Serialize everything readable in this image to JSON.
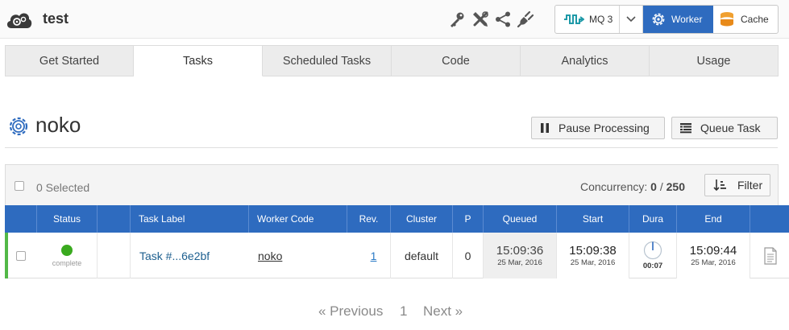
{
  "app": {
    "title": "test",
    "logo_icon": "cloud-gear-icon"
  },
  "toolbar_icons": [
    "key-icon",
    "tools-icon",
    "share-icon",
    "plug-icon"
  ],
  "services": {
    "mq_label": "MQ 3",
    "worker_label": "Worker",
    "cache_label": "Cache",
    "active": "Worker",
    "accent_color": "#2e6bbf"
  },
  "tabs": [
    {
      "label": "Get Started",
      "active": false
    },
    {
      "label": "Tasks",
      "active": true
    },
    {
      "label": "Scheduled Tasks",
      "active": false
    },
    {
      "label": "Code",
      "active": false
    },
    {
      "label": "Analytics",
      "active": false
    },
    {
      "label": "Usage",
      "active": false
    }
  ],
  "page": {
    "title": "noko",
    "pause_label": "Pause Processing",
    "queue_label": "Queue Task"
  },
  "table_toolbar": {
    "selected_text": "0 Selected",
    "concurrency_label": "Concurrency:",
    "concurrency_current": "0",
    "concurrency_sep": "/",
    "concurrency_max": "250",
    "filter_label": "Filter"
  },
  "columns": [
    "Status",
    "",
    "Task Label",
    "Worker Code",
    "Rev.",
    "Cluster",
    "P",
    "Queued",
    "Start",
    "Dura",
    "End",
    ""
  ],
  "rows": [
    {
      "status": "complete",
      "status_color": "#3aaa1f",
      "task_label": "Task #...6e2bf",
      "worker_code": "noko",
      "rev": "1",
      "cluster": "default",
      "priority": "0",
      "queued_time": "15:09:36",
      "queued_date": "25 Mar, 2016",
      "start_time": "15:09:38",
      "start_date": "25 Mar, 2016",
      "duration": "00:07",
      "end_time": "15:09:44",
      "end_date": "25 Mar, 2016",
      "log_icon": "document-icon"
    }
  ],
  "pagination": {
    "previous_label": "« Previous",
    "page": "1",
    "next_label": "Next »"
  }
}
